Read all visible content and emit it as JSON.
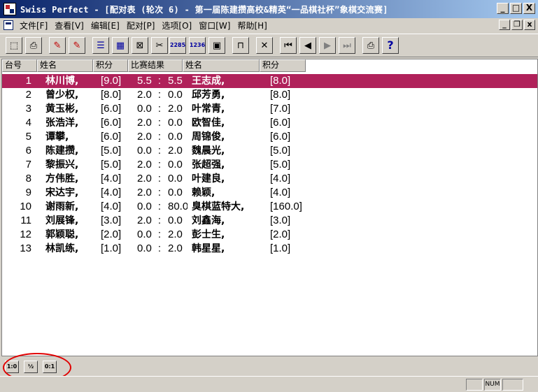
{
  "window": {
    "title": "Swiss Perfect - [配对表  (轮次 6) - 第一届陈建攒高校&精英“一品棋社杯”象棋交流赛]",
    "buttons": {
      "minimize": "_",
      "maximize": "□",
      "close": "X"
    }
  },
  "menu": {
    "items": [
      {
        "label": "文件[F]"
      },
      {
        "label": "查看[V]"
      },
      {
        "label": "编辑[E]"
      },
      {
        "label": "配对[P]"
      },
      {
        "label": "选项[O]"
      },
      {
        "label": "窗口[W]"
      },
      {
        "label": "帮助[H]"
      }
    ],
    "mdi_buttons": {
      "minimize": "_",
      "restore": "❐",
      "close": "x"
    }
  },
  "toolbar": {
    "buttons": [
      {
        "icon": "new-tournament-icon",
        "glyph": "⬚",
        "color": "black"
      },
      {
        "icon": "open-tournament-icon",
        "glyph": "⎙",
        "color": "black"
      },
      {
        "icon": "add-player-icon",
        "glyph": "✎",
        "color": "red"
      },
      {
        "icon": "delete-player-icon",
        "glyph": "✎",
        "color": "red"
      },
      {
        "icon": "player-list-icon",
        "glyph": "☰",
        "color": "blue"
      },
      {
        "icon": "pairing-table-icon",
        "glyph": "▦",
        "color": "blue"
      },
      {
        "icon": "cross-table-icon",
        "glyph": "⊠",
        "color": "black"
      },
      {
        "icon": "pair-round-icon",
        "glyph": "✂",
        "color": "black"
      },
      {
        "icon": "rating-2285-icon",
        "glyph": "2285",
        "color": "blue"
      },
      {
        "icon": "rating-1236-icon",
        "glyph": "1236",
        "color": "blue"
      },
      {
        "icon": "image-icon",
        "glyph": "▣",
        "color": "black"
      },
      {
        "icon": "table-view-icon",
        "glyph": "⊓",
        "color": "black"
      },
      {
        "icon": "scissors-icon",
        "glyph": "✕",
        "color": "black"
      },
      {
        "icon": "first-record-icon",
        "glyph": "⏮",
        "color": "black"
      },
      {
        "icon": "prev-record-icon",
        "glyph": "◀",
        "color": "black"
      },
      {
        "icon": "next-record-icon",
        "glyph": "▶",
        "color": "gray"
      },
      {
        "icon": "last-record-icon",
        "glyph": "⏭",
        "color": "gray"
      },
      {
        "icon": "print-icon",
        "glyph": "⎙",
        "color": "black"
      },
      {
        "icon": "help-icon",
        "glyph": "?",
        "color": "blue"
      }
    ]
  },
  "columns": {
    "board": "台号",
    "white_name": "姓名",
    "white_score": "积分",
    "result": "比赛结果",
    "black_name": "姓名",
    "black_score": "积分"
  },
  "pairings": [
    {
      "board": "1",
      "white": "林川博,",
      "white_score": "[9.0]",
      "r1": "5.5",
      "r2": "5.5",
      "black": "王志成,",
      "black_score": "[8.0]",
      "selected": true
    },
    {
      "board": "2",
      "white": "曾少权,",
      "white_score": "[8.0]",
      "r1": "2.0",
      "r2": "0.0",
      "black": "邱芳勇,",
      "black_score": "[8.0]"
    },
    {
      "board": "3",
      "white": "黄玉彬,",
      "white_score": "[6.0]",
      "r1": "0.0",
      "r2": "2.0",
      "black": "叶常青,",
      "black_score": "[7.0]"
    },
    {
      "board": "4",
      "white": "张浩洋,",
      "white_score": "[6.0]",
      "r1": "2.0",
      "r2": "0.0",
      "black": "欧智佳,",
      "black_score": "[6.0]"
    },
    {
      "board": "5",
      "white": "谭攀,",
      "white_score": "[6.0]",
      "r1": "2.0",
      "r2": "0.0",
      "black": "周锦俊,",
      "black_score": "[6.0]"
    },
    {
      "board": "6",
      "white": "陈建攒,",
      "white_score": "[5.0]",
      "r1": "0.0",
      "r2": "2.0",
      "black": "魏晨光,",
      "black_score": "[5.0]"
    },
    {
      "board": "7",
      "white": "黎振兴,",
      "white_score": "[5.0]",
      "r1": "2.0",
      "r2": "0.0",
      "black": "张超强,",
      "black_score": "[5.0]"
    },
    {
      "board": "8",
      "white": "方伟胜,",
      "white_score": "[4.0]",
      "r1": "2.0",
      "r2": "0.0",
      "black": "叶建良,",
      "black_score": "[4.0]"
    },
    {
      "board": "9",
      "white": "宋达宇,",
      "white_score": "[4.0]",
      "r1": "2.0",
      "r2": "0.0",
      "black": "赖颖,",
      "black_score": "[4.0]"
    },
    {
      "board": "10",
      "white": "谢雨新,",
      "white_score": "[4.0]",
      "r1": "0.0",
      "r2": "80.0",
      "black": "臭棋蓝特大,",
      "black_score": "[160.0]"
    },
    {
      "board": "11",
      "white": "刘展锋,",
      "white_score": "[3.0]",
      "r1": "2.0",
      "r2": "0.0",
      "black": "刘鑫海,",
      "black_score": "[3.0]"
    },
    {
      "board": "12",
      "white": "郭颖聪,",
      "white_score": "[2.0]",
      "r1": "0.0",
      "r2": "2.0",
      "black": "彭士生,",
      "black_score": "[2.0]"
    },
    {
      "board": "13",
      "white": "林凯练,",
      "white_score": "[1.0]",
      "r1": "0.0",
      "r2": "2.0",
      "black": "韩星星,",
      "black_score": "[1.0]"
    }
  ],
  "result_buttons": [
    {
      "label": "1:0"
    },
    {
      "label": "½"
    },
    {
      "label": "0:1"
    }
  ],
  "status": {
    "num": "NUM"
  },
  "colors": {
    "selected_row": "#b0215a",
    "annotation": "#e00000",
    "title_start": "#0a246a",
    "title_end": "#a6caf0"
  }
}
